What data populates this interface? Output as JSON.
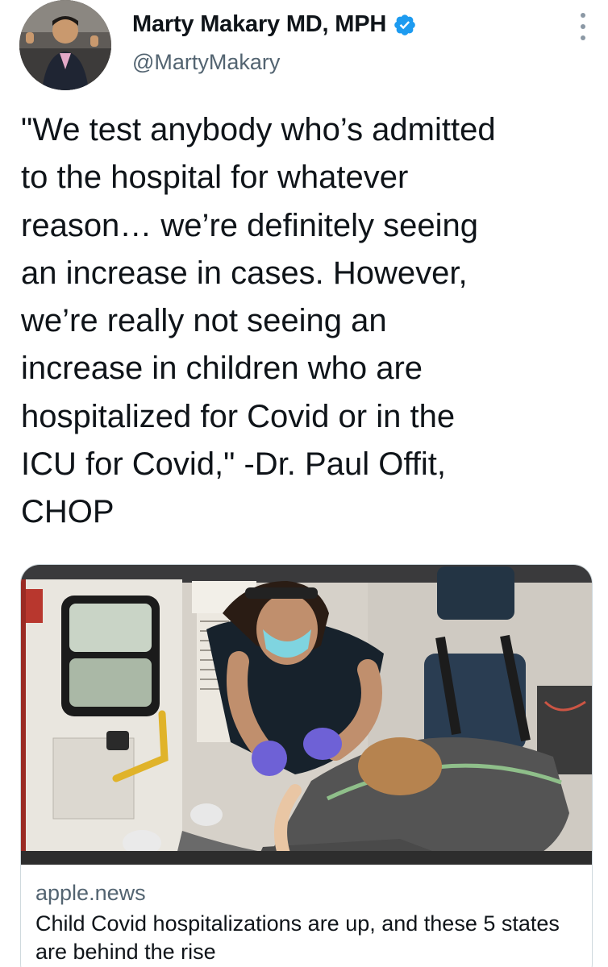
{
  "author": {
    "display_name": "Marty Makary MD, MPH",
    "handle": "@MartyMakary",
    "verified": true,
    "avatar_icon": "profile-photo"
  },
  "tweet": {
    "text": "\"We test anybody who’s admitted\nto the hospital for whatever\nreason… we’re definitely seeing\nan increase in cases. However,\nwe’re really not seeing an\nincrease in children who are\nhospitalized for Covid or in the\nICU for Covid,\" -Dr. Paul Offit,\nCHOP"
  },
  "card": {
    "domain": "apple.news",
    "title": "Child Covid hospitalizations are up, and these 5 states are behind the rise",
    "image_icon": "ambulance-photo"
  },
  "colors": {
    "text_primary": "#0f1419",
    "text_secondary": "#536471",
    "verified_blue": "#1d9bf0",
    "border": "#cfd9de"
  }
}
